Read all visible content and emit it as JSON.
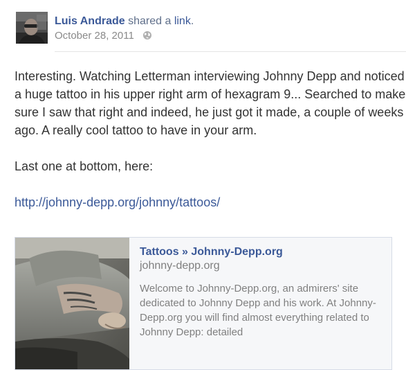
{
  "story": {
    "actor_name": "Luis Andrade",
    "verb": "shared a",
    "object": "link",
    "period": ".",
    "timestamp": "October 28, 2011",
    "privacy_icon": "globe-icon"
  },
  "message": {
    "paragraph_1": "Interesting. Watching Letterman interviewing Johnny Depp and noticed a huge tattoo in his upper right arm of hexagram 9... Searched to make sure I saw that right and indeed, he just got it made, a couple of weeks ago. A really cool tattoo to have in your arm.",
    "paragraph_2": "Last one at bottom, here:",
    "link": "http://johnny-depp.org/johnny/tattoos/"
  },
  "attachment": {
    "title": "Tattoos » Johnny-Depp.org",
    "domain": "johnny-depp.org",
    "description": "Welcome to Johnny-Depp.org, an admirers' site dedicated to Johnny Depp and his work. At Johnny-Depp.org you will find almost everything related to Johnny Depp: detailed"
  },
  "colors": {
    "link_blue": "#3b5998",
    "meta_gray": "#8a8a8a",
    "attachment_bg": "#f6f7f9"
  }
}
